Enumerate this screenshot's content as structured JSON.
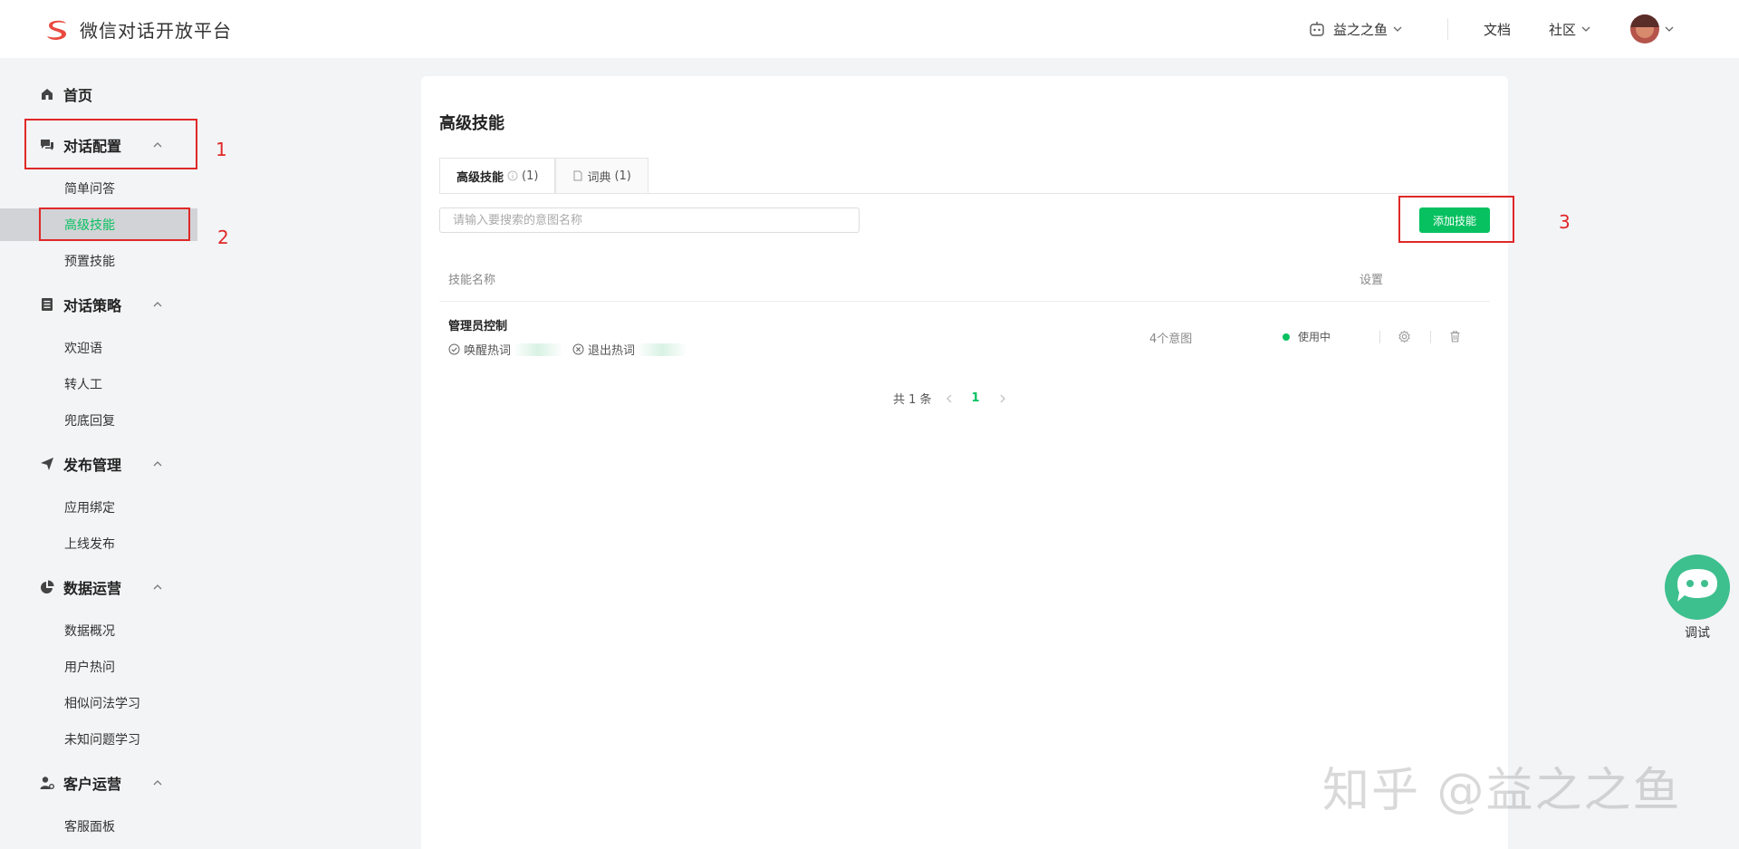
{
  "app": {
    "title": "微信对话开放平台",
    "brand_color": "#07c160",
    "logo_color": "#e94a3f"
  },
  "header": {
    "bot_name": "益之之鱼",
    "docs": "文档",
    "community": "社区"
  },
  "sidebar": {
    "home": "首页",
    "groups": [
      {
        "label": "对话配置",
        "items": [
          "简单问答",
          "高级技能",
          "预置技能"
        ]
      },
      {
        "label": "对话策略",
        "items": [
          "欢迎语",
          "转人工",
          "兜底回复"
        ]
      },
      {
        "label": "发布管理",
        "items": [
          "应用绑定",
          "上线发布"
        ]
      },
      {
        "label": "数据运营",
        "items": [
          "数据概况",
          "用户热问",
          "相似问法学习",
          "未知问题学习"
        ]
      },
      {
        "label": "客户运营",
        "items": [
          "客服面板"
        ]
      }
    ],
    "active_item": "高级技能"
  },
  "main": {
    "title": "高级技能",
    "tabs": [
      {
        "label": "高级技能",
        "count": "(1)"
      },
      {
        "label": "词典",
        "count": "(1)"
      }
    ],
    "search_placeholder": "请输入要搜索的意图名称",
    "add_button": "添加技能",
    "columns": {
      "name": "技能名称",
      "settings": "设置"
    },
    "rows": [
      {
        "name": "管理员控制",
        "wake_label": "唤醒热词",
        "exit_label": "退出热词",
        "intents": "4个意图",
        "status": "使用中"
      }
    ],
    "pagination": {
      "total": "共 1 条",
      "current": "1"
    }
  },
  "annotations": [
    "1",
    "2",
    "3"
  ],
  "debug": {
    "label": "调试"
  },
  "watermark": "知乎 @益之之鱼"
}
